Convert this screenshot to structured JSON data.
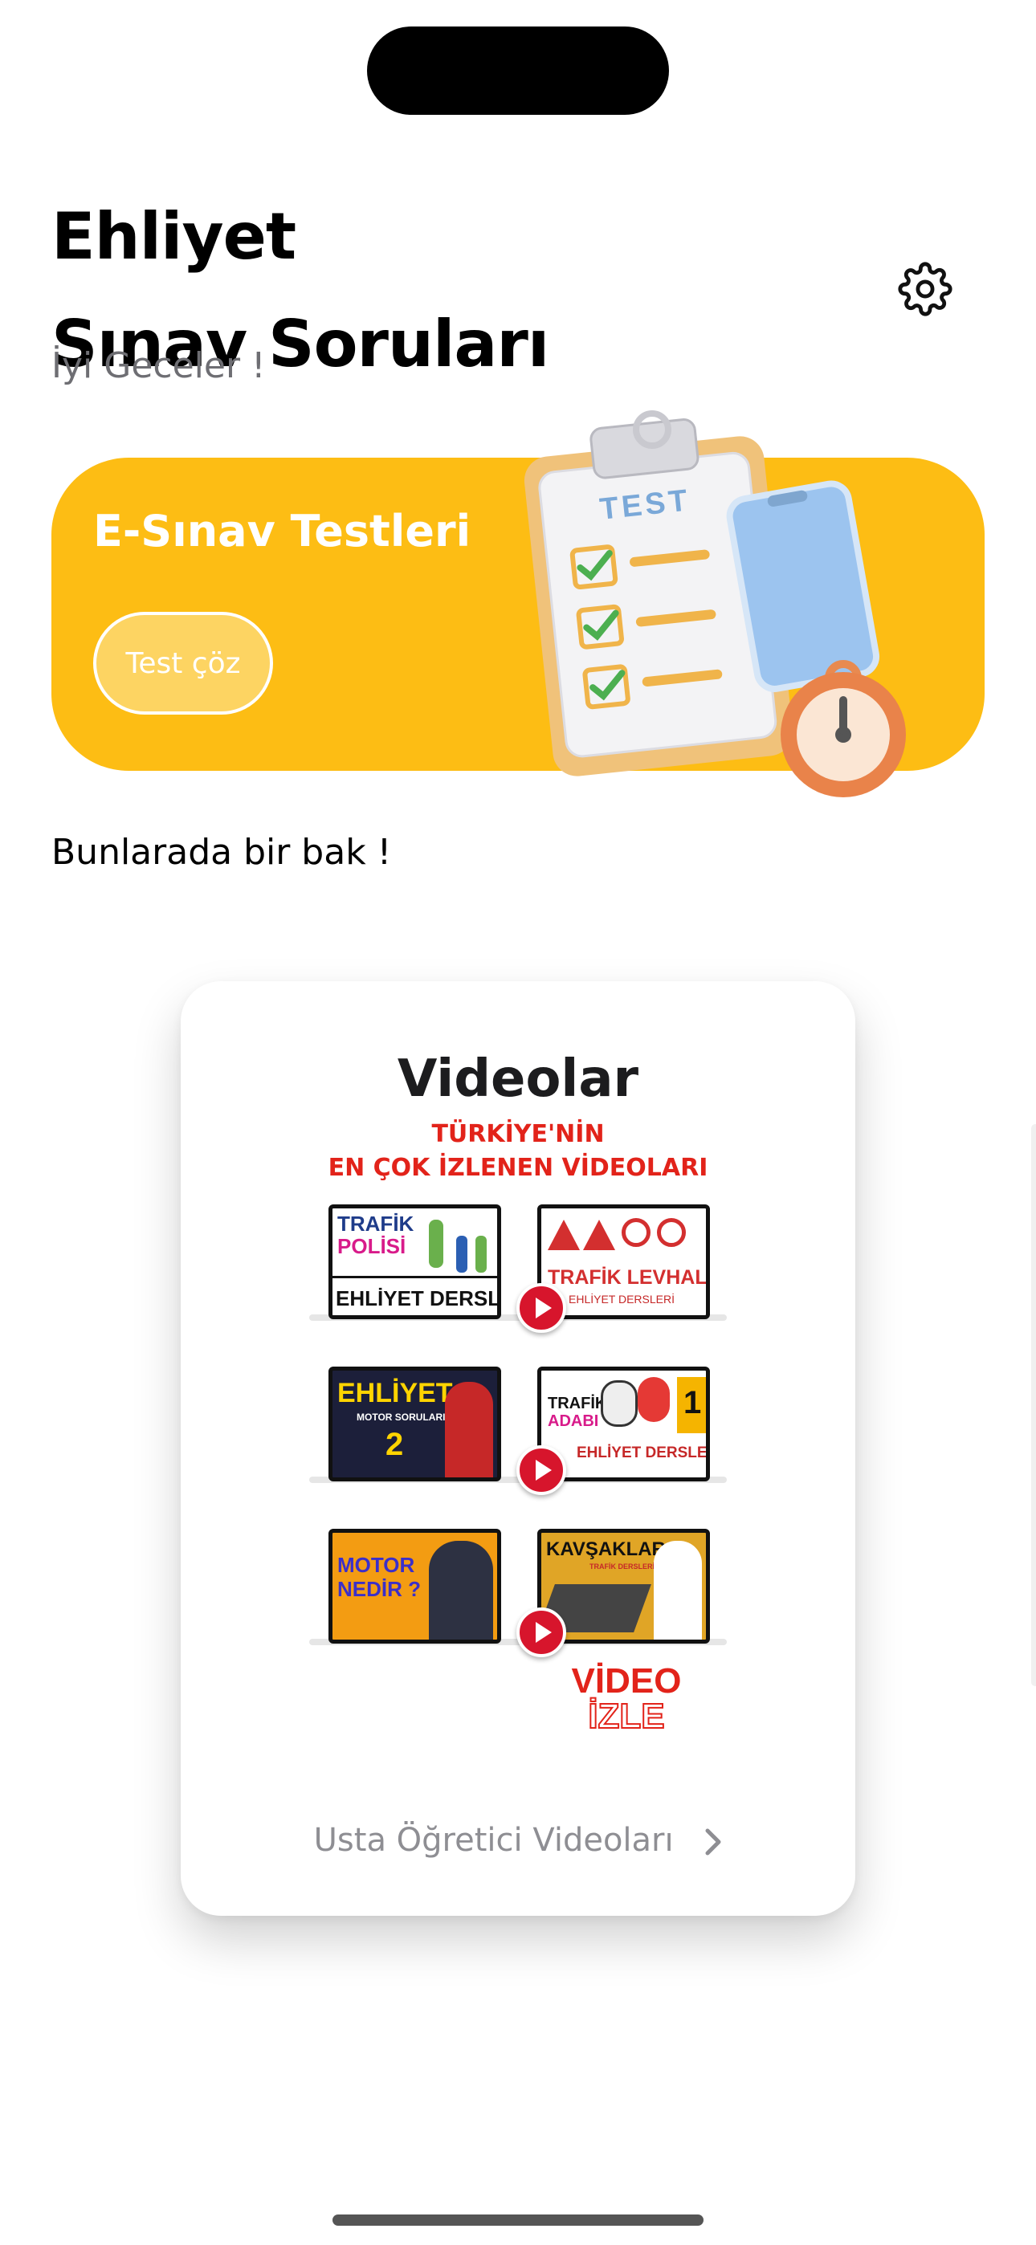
{
  "header": {
    "title_line1": "Ehliyet",
    "title_line2": "Sınav Soruları",
    "greeting": "İyi Geceler !",
    "settings_icon": "gear-icon"
  },
  "banner": {
    "title": "E-Sınav Testleri",
    "button_label": "Test çöz",
    "illustration_label": "TEST",
    "color": "#fdbd14"
  },
  "section": {
    "heading": "Bunlarada bir bak !"
  },
  "video_card": {
    "title": "Videolar",
    "promo_line1": "TÜRKİYE'NİN",
    "promo_line2": "EN ÇOK İZLENEN VİDEOLARI",
    "thumbnails": [
      {
        "line1": "TRAFİK",
        "line2": "POLİSİ",
        "line3": "EHLİYET DERSLERİ"
      },
      {
        "line1": "TRAFİK LEVHALARI",
        "line2": "EHLİYET DERSLERİ"
      },
      {
        "line1": "EHLİYET",
        "line2": "MOTOR SORULARI",
        "line3": "2"
      },
      {
        "line1": "TRAFİK",
        "line2": "ADABI",
        "line3": "EHLİYET DERSLERİ",
        "badge": "1"
      },
      {
        "line1": "MOTOR",
        "line2": "NEDİR ?"
      },
      {
        "line1": "KAVŞAKLAR",
        "line2": "TRAFİK DERSLERİ"
      }
    ],
    "cta_line1": "VİDEO",
    "cta_line2": "İZLE",
    "footer_link": "Usta Öğretici Videoları"
  },
  "colors": {
    "accent_yellow": "#fdbd14",
    "promo_red": "#e2231a",
    "footer_gray": "#8e8e93"
  }
}
